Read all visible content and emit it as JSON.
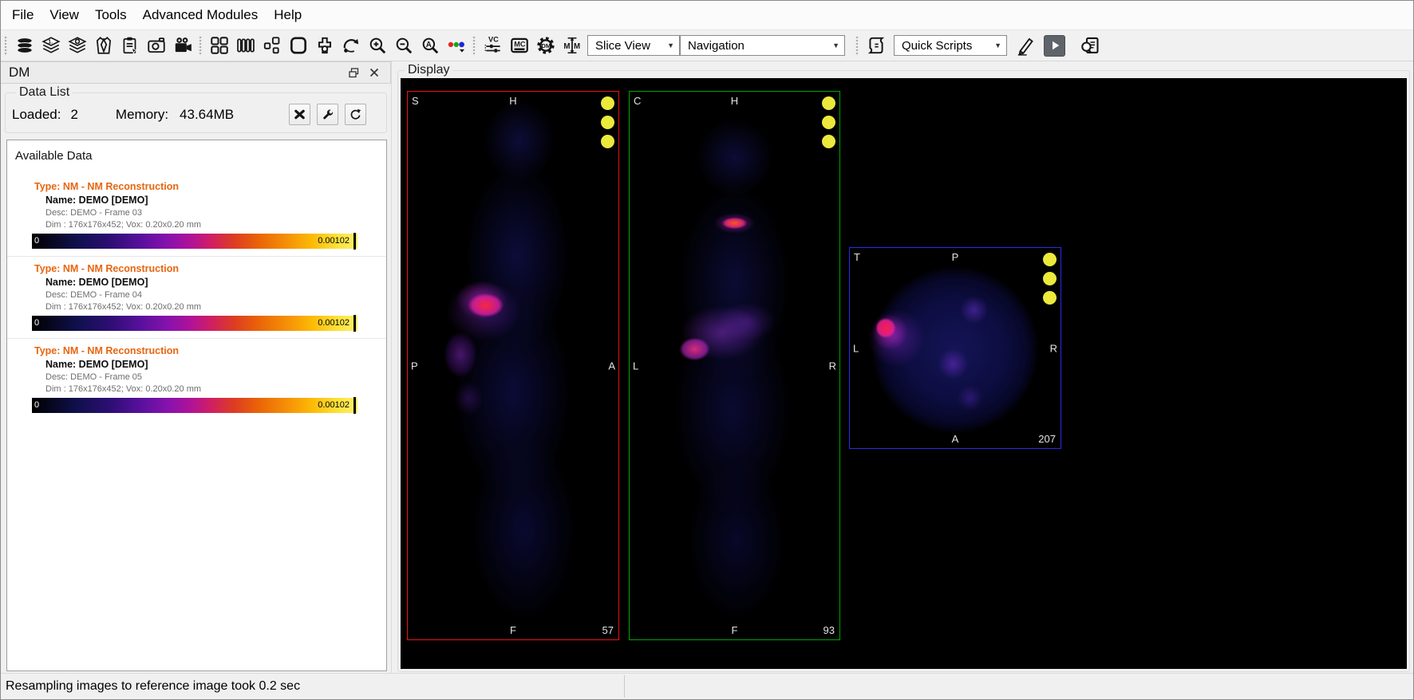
{
  "menu_bar": {
    "items": [
      "File",
      "View",
      "Tools",
      "Advanced Modules",
      "Help"
    ]
  },
  "toolbar": {
    "icon_names": {
      "data_group": [
        "data-stack-icon",
        "layers-reorder-icon",
        "layers-add-icon",
        "subject-icon",
        "clipboard-paste-icon",
        "snapshot-camera-icon",
        "movie-camera-icon"
      ],
      "view_group": [
        "layout-grid-icon",
        "layout-columns-icon",
        "layout-custom-icon",
        "layout-single-icon",
        "register-tool-icon",
        "rotate-view-icon",
        "zoom-in-icon",
        "zoom-out-icon",
        "zoom-auto-icon",
        "color-channels-icon"
      ],
      "module_group": [
        "vc-module-icon",
        "mc-module-icon",
        "dm-module-icon",
        "mm-module-icon"
      ],
      "script_group": [
        "script-icon",
        "edit-script-icon",
        "run-script-icon",
        "script-report-icon"
      ]
    },
    "slice_view_dropdown": "Slice View",
    "navigation_dropdown": "Navigation",
    "quick_scripts_dropdown": "Quick Scripts"
  },
  "dm_panel": {
    "title": "DM",
    "group_label": "Data List",
    "loaded_label": "Loaded:",
    "loaded_value": "2",
    "memory_label": "Memory:",
    "memory_value": "43.64MB",
    "list_label": "Available Data",
    "type_color": "#e8650f",
    "entries": [
      {
        "type": "Type: NM - NM Reconstruction",
        "name": "Name: DEMO [DEMO]",
        "desc": "Desc: DEMO - Frame 03",
        "dim": "Dim : 176x176x452; Vox: 0.20x0.20 mm",
        "bar_min": "0",
        "bar_max": "0.00102"
      },
      {
        "type": "Type: NM - NM Reconstruction",
        "name": "Name: DEMO [DEMO]",
        "desc": "Desc: DEMO - Frame 04",
        "dim": "Dim : 176x176x452; Vox: 0.20x0.20 mm",
        "bar_min": "0",
        "bar_max": "0.00102"
      },
      {
        "type": "Type: NM - NM Reconstruction",
        "name": "Name: DEMO [DEMO]",
        "desc": "Desc: DEMO - Frame 05",
        "dim": "Dim : 176x176x452; Vox: 0.20x0.20 mm",
        "bar_min": "0",
        "bar_max": "0.00102"
      }
    ]
  },
  "display": {
    "group_label": "Display",
    "marker_color": "#ebe93c",
    "views": [
      {
        "id": "sagittal",
        "border_color": "#ee1111",
        "top_left": "S",
        "top_center": "H",
        "mid_left": "P",
        "mid_right": "A",
        "bottom_center": "F",
        "slice_number": "57"
      },
      {
        "id": "coronal",
        "border_color": "#00a400",
        "top_left": "C",
        "top_center": "H",
        "mid_left": "L",
        "mid_right": "R",
        "bottom_center": "F",
        "slice_number": "93"
      },
      {
        "id": "transverse",
        "border_color": "#2a2aee",
        "top_left": "T",
        "top_center": "P",
        "mid_left": "L",
        "mid_right": "R",
        "bottom_center": "A",
        "slice_number": "207"
      }
    ]
  },
  "status_bar": {
    "message": "Resampling images to reference image took 0.2 sec"
  }
}
